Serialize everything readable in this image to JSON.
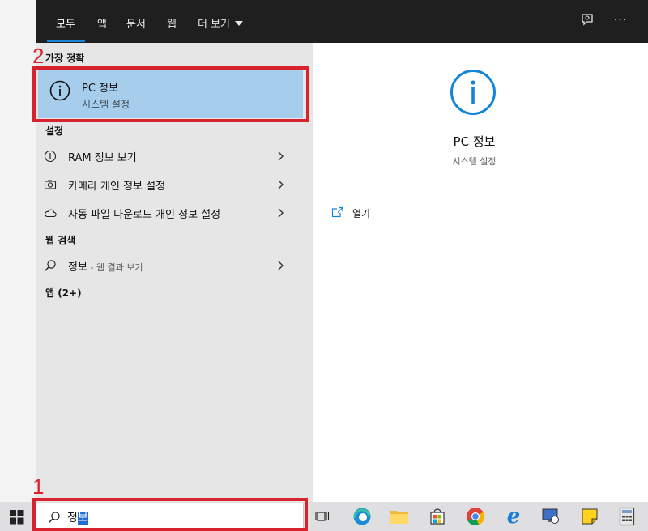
{
  "tabs": [
    {
      "label": "모두",
      "active": true
    },
    {
      "label": "앱"
    },
    {
      "label": "문서"
    },
    {
      "label": "웹"
    },
    {
      "label": "더 보기"
    }
  ],
  "topbar_icons": [
    "feedback-icon",
    "more-options-icon"
  ],
  "more_label": "···",
  "best_match": {
    "section_label": "가장 정확",
    "title": "PC 정보",
    "subtitle": "시스템 설정",
    "icon": "info-icon"
  },
  "settings_section": {
    "label": "설정",
    "items": [
      {
        "label": "RAM 정보 보기",
        "icon": "info-icon"
      },
      {
        "label": "카메라 개인 정보 설정",
        "icon": "camera-icon"
      },
      {
        "label": "자동 파일 다운로드 개인 정보 설정",
        "icon": "cloud-icon"
      }
    ]
  },
  "web_section": {
    "label": "웹 검색",
    "item": {
      "query": "정보",
      "suffix": " - 웹 결과 보기",
      "icon": "search-icon"
    }
  },
  "apps_section": {
    "label": "앱 (2+)"
  },
  "preview": {
    "title": "PC 정보",
    "subtitle": "시스템 설정",
    "action_label": "열기",
    "action_icon": "open-icon"
  },
  "taskbar": {
    "search_text_plain": "정",
    "search_text_selected": "보",
    "apps": [
      "task-view-icon",
      "edge-icon",
      "file-explorer-icon",
      "store-icon",
      "chrome-icon",
      "ie-icon",
      "remote-desktop-icon",
      "sticky-notes-icon",
      "calculator-icon"
    ]
  },
  "annotations": {
    "step1": "1",
    "step2": "2",
    "color": "#d8232e"
  },
  "colors": {
    "accent": "#1585d7",
    "highlight": "#a7cdec",
    "topbar": "#1f1f1f",
    "left_pane": "#e6e6e6"
  }
}
